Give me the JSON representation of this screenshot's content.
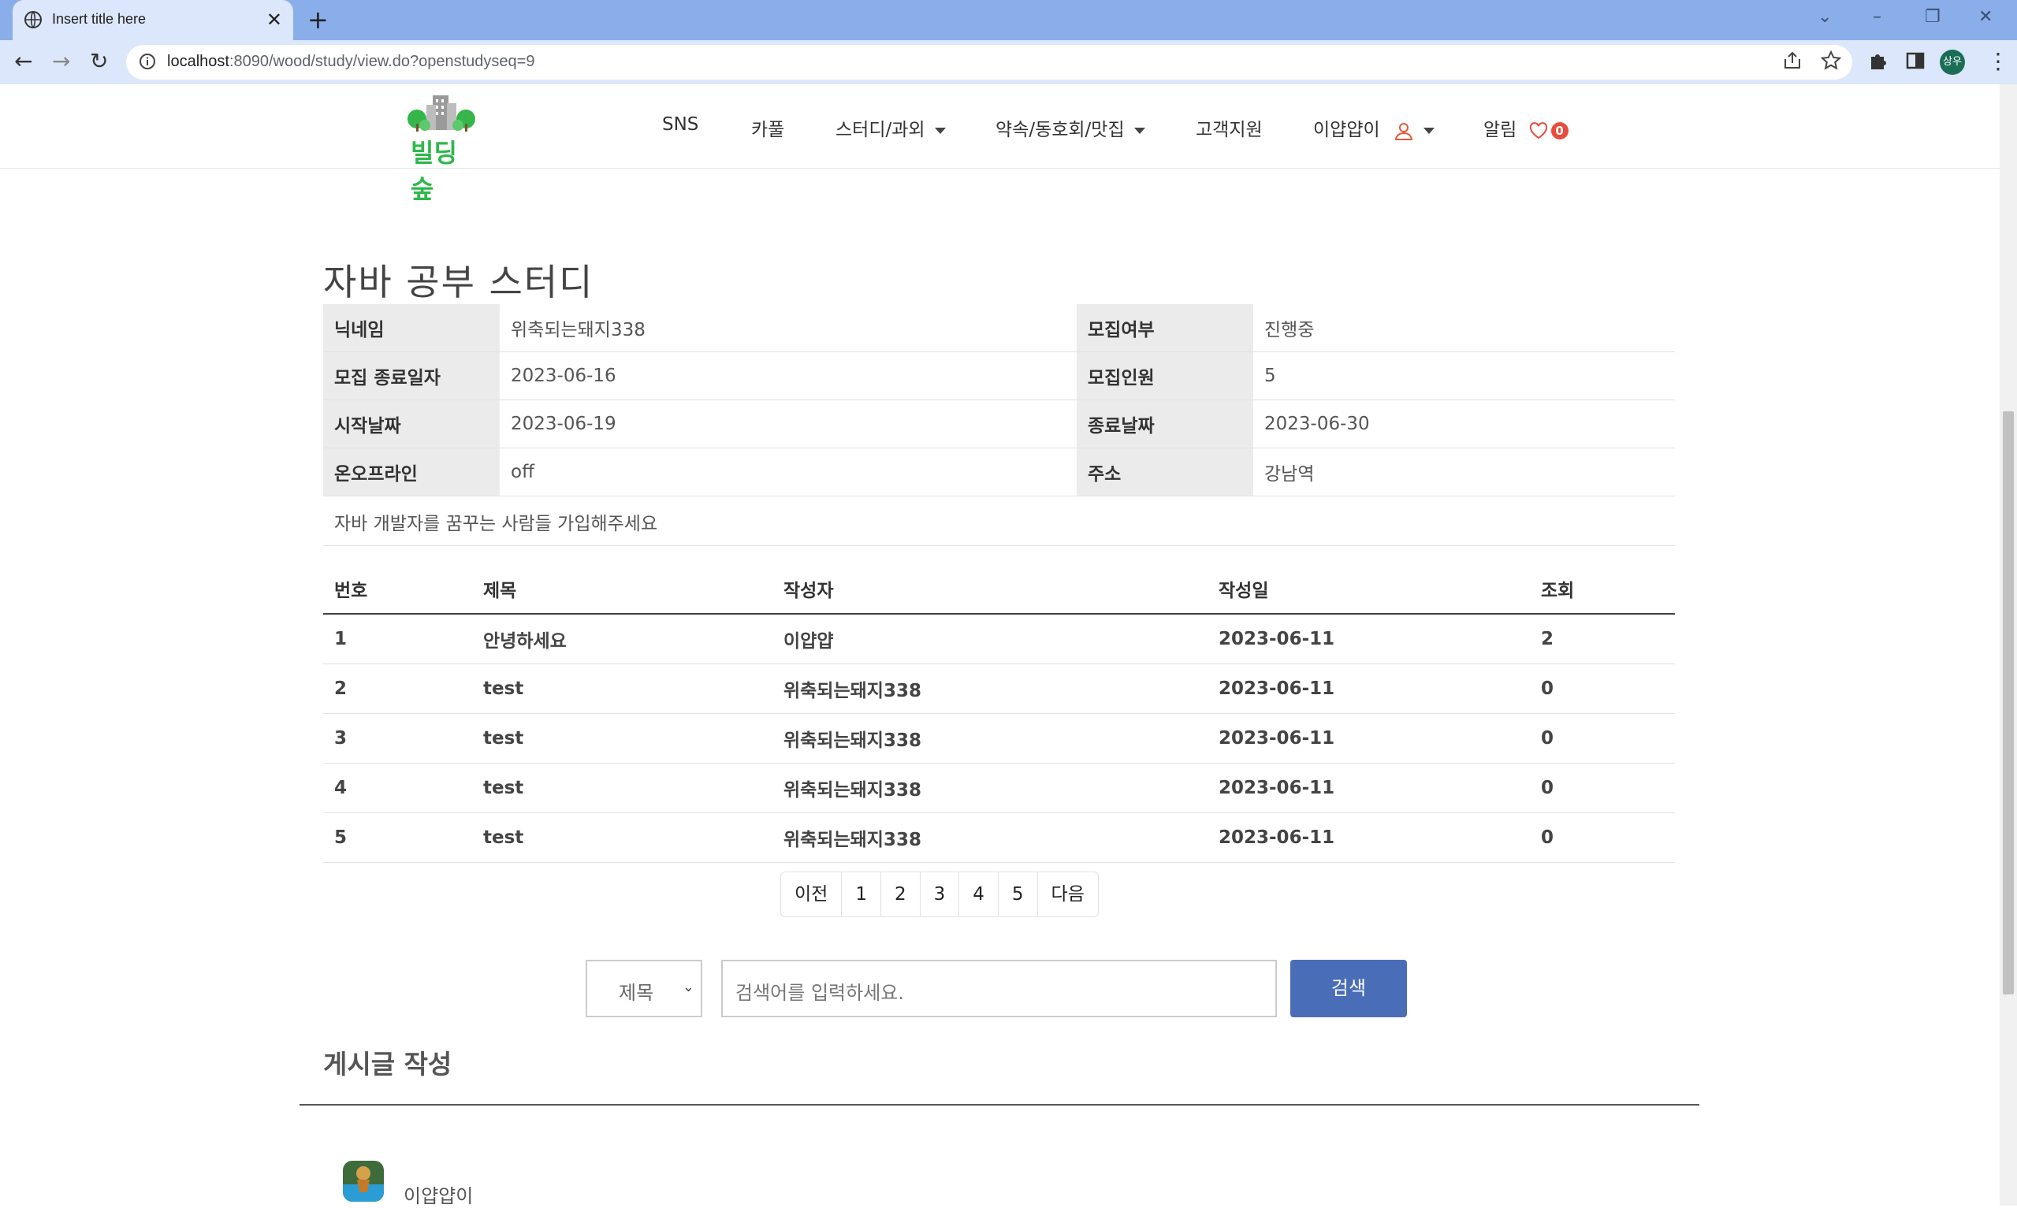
{
  "browser": {
    "tab_title": "Insert title here",
    "tab_close": "✕",
    "new_tab": "+",
    "url_host": "localhost",
    "url_rest": ":8090/wood/study/view.do?openstudyseq=9",
    "profile_initials": "상우"
  },
  "site": {
    "logo_text": "빌딩숲",
    "nav": {
      "sns": "SNS",
      "carpool": "카풀",
      "study": "스터디/과외",
      "meetup": "약속/동호회/맛집",
      "support": "고객지원",
      "user": "이얍얍이",
      "alarm": "알림",
      "alarm_count": "0"
    }
  },
  "study": {
    "title": "자바 공부 스터디",
    "fields": {
      "nickname_label": "닉네임",
      "nickname": "위축되는돼지338",
      "recruit_status_label": "모집여부",
      "recruit_status": "진행중",
      "recruit_end_label": "모집 종료일자",
      "recruit_end": "2023-06-16",
      "recruit_count_label": "모집인원",
      "recruit_count": "5",
      "start_label": "시작날짜",
      "start": "2023-06-19",
      "end_label": "종료날짜",
      "end": "2023-06-30",
      "online_label": "온오프라인",
      "online": "off",
      "address_label": "주소",
      "address": "강남역"
    },
    "description": "자바 개발자를 꿈꾸는 사람들 가입해주세요"
  },
  "posts": {
    "headers": [
      "번호",
      "제목",
      "작성자",
      "작성일",
      "조회"
    ],
    "rows": [
      [
        "1",
        "안녕하세요",
        "이얍얍",
        "2023-06-11",
        "2"
      ],
      [
        "2",
        "test",
        "위축되는돼지338",
        "2023-06-11",
        "0"
      ],
      [
        "3",
        "test",
        "위축되는돼지338",
        "2023-06-11",
        "0"
      ],
      [
        "4",
        "test",
        "위축되는돼지338",
        "2023-06-11",
        "0"
      ],
      [
        "5",
        "test",
        "위축되는돼지338",
        "2023-06-11",
        "0"
      ]
    ]
  },
  "pagination": {
    "prev": "이전",
    "pages": [
      "1",
      "2",
      "3",
      "4",
      "5"
    ],
    "next": "다음"
  },
  "search": {
    "select_value": "제목",
    "placeholder": "검색어를 입력하세요.",
    "button": "검색"
  },
  "write": {
    "heading": "게시글 작성",
    "author": "이얍얍이"
  }
}
